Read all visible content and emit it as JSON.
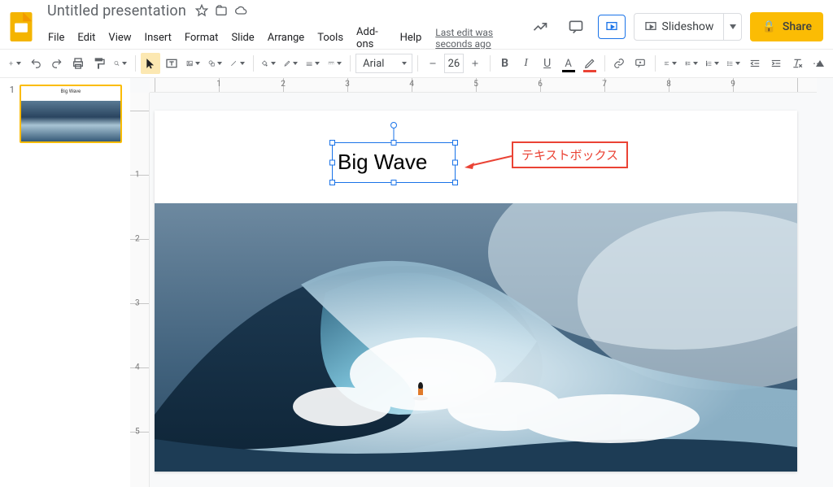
{
  "header": {
    "doc_title": "Untitled presentation",
    "last_edit": "Last edit was seconds ago"
  },
  "menus": {
    "file": "File",
    "edit": "Edit",
    "view": "View",
    "insert": "Insert",
    "format": "Format",
    "slide": "Slide",
    "arrange": "Arrange",
    "tools": "Tools",
    "addons": "Add-ons",
    "help": "Help"
  },
  "controls": {
    "slideshow": "Slideshow",
    "share": "Share"
  },
  "toolbar": {
    "font": "Arial",
    "font_size": "26"
  },
  "ruler": {
    "h_labels": [
      "1",
      "2",
      "3",
      "4",
      "5",
      "6",
      "7",
      "8",
      "9"
    ],
    "v_labels": [
      "1",
      "2",
      "3",
      "4",
      "5"
    ]
  },
  "slide": {
    "title_text": "Big Wave"
  },
  "annotation": {
    "label": "テキストボックス"
  },
  "thumbs": {
    "slide1_number": "1",
    "slide1_title": "Big Wave"
  }
}
